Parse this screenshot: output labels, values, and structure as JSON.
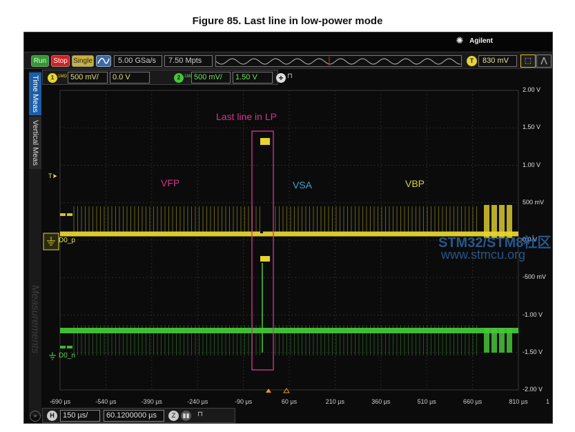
{
  "figure_title": "Figure 85. Last line in low-power mode",
  "brand": {
    "name": "Agilent",
    "icon": "agilent-spark-icon"
  },
  "toolbar": {
    "run_label": "Run",
    "stop_label": "Stop",
    "single_label": "Single",
    "auto_icon": "auto-scale-icon",
    "sample_rate": "5.00 GSa/s",
    "memory_depth": "7.50 Mpts",
    "trigger_badge": "T",
    "trigger_level": "830 mV",
    "zoom_icon": "zoom-icon",
    "run_icon": "run-icon"
  },
  "channels": [
    {
      "badge": "1",
      "impedance": "1MΩ",
      "scale": "500 mV/",
      "offset": "0.0 V",
      "color": "#e6d52f"
    },
    {
      "badge": "2",
      "impedance": "1MΩ",
      "scale": "500 mV/",
      "offset": "1.50 V",
      "color": "#46c43a"
    }
  ],
  "side_tabs": {
    "time_meas": "Time Meas",
    "vertical_meas": "Vertical Meas",
    "measurements": "Measurements"
  },
  "annotations": {
    "last_line": "Last line in LP",
    "vfp": "VFP",
    "vsa": "VSA",
    "vbp": "VBP"
  },
  "voltage_labels": [
    "2.00 V",
    "1.50 V",
    "1.00 V",
    "500 mV",
    "0.0 V",
    "-500 mV",
    "-1.00 V",
    "-1.50 V",
    "-2.00 V"
  ],
  "time_ticks": [
    "-690 µs",
    "-540 µs",
    "-390 µs",
    "-240 µs",
    "-90 µs",
    "60 µs",
    "210 µs",
    "360 µs",
    "510 µs",
    "660 µs",
    "810 µs"
  ],
  "time_tick_end": "1",
  "trace_labels": {
    "d0p": "D0_p",
    "d0n": "D0_n",
    "trigger_marker": "T"
  },
  "watermark": {
    "line1": "STM32/STM8社区",
    "line2": "www.stmcu.org"
  },
  "bottom_bar": {
    "h_badge": "H",
    "h_scale": "150 µs/",
    "h_delay": "60.1200000 µs",
    "nav_z": "Z"
  }
}
